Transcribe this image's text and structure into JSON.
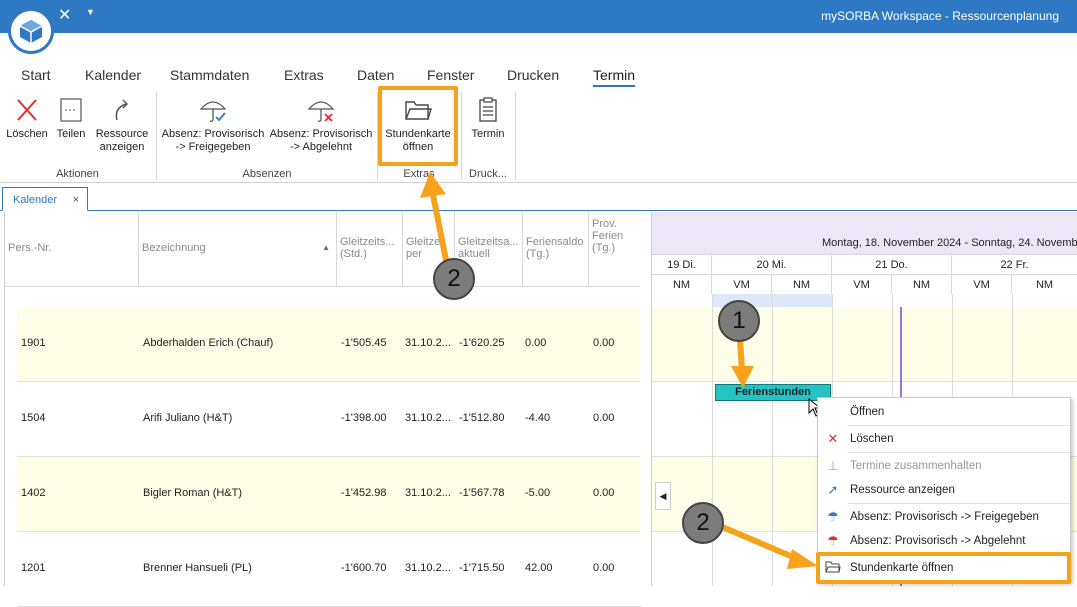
{
  "window": {
    "title": "mySORBA Workspace - Ressourcenplanung"
  },
  "menu": [
    {
      "label": "Start"
    },
    {
      "label": "Kalender"
    },
    {
      "label": "Stammdaten"
    },
    {
      "label": "Extras"
    },
    {
      "label": "Daten"
    },
    {
      "label": "Fenster"
    },
    {
      "label": "Drucken"
    },
    {
      "label": "Termin"
    }
  ],
  "ribbon": {
    "loeschen": "Löschen",
    "teilen": "Teilen",
    "ressource_line1": "Ressource",
    "ressource_line2": "anzeigen",
    "absenz_frei_line1": "Absenz: Provisorisch",
    "absenz_frei_line2": "-> Freigegeben",
    "absenz_abg_line1": "Absenz: Provisorisch",
    "absenz_abg_line2": "-> Abgelehnt",
    "stundenkarte_line1": "Stundenkarte",
    "stundenkarte_line2": "öffnen",
    "termin": "Termin",
    "groups": {
      "aktionen": "Aktionen",
      "absenzen": "Absenzen",
      "extras": "Extras",
      "druck": "Druck..."
    }
  },
  "tab": {
    "label": "Kalender",
    "close": "×"
  },
  "columns": {
    "persnr": "Pers.-Nr.",
    "bezeichnung": "Bezeichnung",
    "gleitzeit_std_1": "Gleitzeits...",
    "gleitzeit_std_2": "(Std.)",
    "gleitzeit_per_1": "Gleitze",
    "gleitzeit_per_2": "per",
    "gleitzeit_akt_1": "Gleitzeitsa...",
    "gleitzeit_akt_2": "aktuell",
    "ferien_1": "Feriensaldo",
    "ferien_2": "(Tg.)",
    "prov_1": "Prov.",
    "prov_2": "Ferien",
    "prov_3": "(Tg.)"
  },
  "rows": [
    {
      "persnr": "1901",
      "name": "Abderhalden Erich (Chauf)",
      "gz_std": "-1'505.45",
      "gz_per": "31.10.2...",
      "gz_akt": "-1'620.25",
      "ferien": "0.00",
      "prov": "0.00"
    },
    {
      "persnr": "1504",
      "name": "Arifi Juliano (H&T)",
      "gz_std": "-1'398.00",
      "gz_per": "31.10.2...",
      "gz_akt": "-1'512.80",
      "ferien": "-4.40",
      "prov": "0.00"
    },
    {
      "persnr": "1402",
      "name": "Bigler Roman (H&T)",
      "gz_std": "-1'452.98",
      "gz_per": "31.10.2...",
      "gz_akt": "-1'567.78",
      "ferien": "-5.00",
      "prov": "0.00"
    },
    {
      "persnr": "1201",
      "name": "Brenner Hansueli (PL)",
      "gz_std": "-1'600.70",
      "gz_per": "31.10.2...",
      "gz_akt": "-1'715.50",
      "ferien": "42.00",
      "prov": "0.00"
    }
  ],
  "calendar": {
    "range": "Montag, 18. November 2024 - Sonntag, 24. November",
    "days": [
      {
        "label": "19 Di."
      },
      {
        "label": "20 Mi."
      },
      {
        "label": "21 Do."
      },
      {
        "label": "22 Fr."
      }
    ],
    "halves": [
      "NM",
      "VM",
      "NM",
      "VM",
      "NM",
      "VM",
      "NM"
    ],
    "termin_label": "Ferienstunden"
  },
  "context_menu": {
    "oeffnen": "Öffnen",
    "loeschen": "Löschen",
    "zusammen": "Termine zusammenhalten",
    "ressource": "Ressource anzeigen",
    "frei": "Absenz: Provisorisch -> Freigegeben",
    "abgelehnt": "Absenz: Provisorisch -> Abgelehnt",
    "stundenkarte": "Stundenkarte öffnen"
  },
  "annotations": {
    "badge1": "1",
    "badge2a": "2",
    "badge2b": "2"
  },
  "colors": {
    "accent": "#2f78c4",
    "callout": "#f7a21b",
    "termin": "#26c3c3"
  }
}
